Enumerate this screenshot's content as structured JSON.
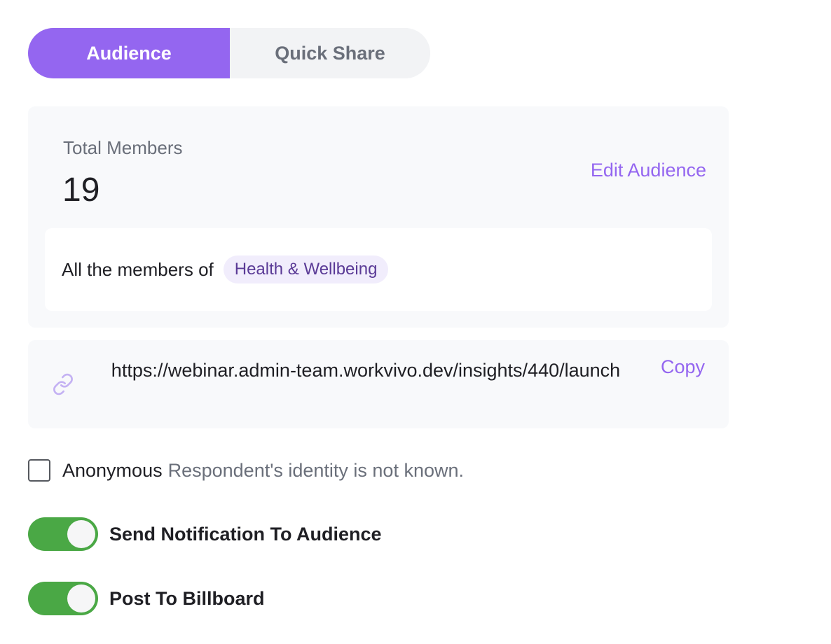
{
  "tabs": [
    {
      "label": "Audience",
      "active": true
    },
    {
      "label": "Quick Share",
      "active": false
    }
  ],
  "audience": {
    "total_label": "Total Members",
    "total_count": "19",
    "edit_label": "Edit Audience",
    "members_prefix": "All the members of",
    "group_name": "Health & Wellbeing"
  },
  "share_link": {
    "icon": "link-icon",
    "url": "https://webinar.admin-team.workvivo.dev/insights/440/launch",
    "copy_label": "Copy"
  },
  "anonymous": {
    "label": "Anonymous",
    "description": "Respondent's identity is not known.",
    "checked": false
  },
  "toggles": [
    {
      "label": "Send Notification To Audience",
      "on": true
    },
    {
      "label": "Post To Billboard",
      "on": true
    }
  ],
  "colors": {
    "accent": "#9466f0",
    "toggle_on": "#4aa845",
    "pill_bg": "#f1edfc",
    "pill_text": "#5a3a96"
  }
}
